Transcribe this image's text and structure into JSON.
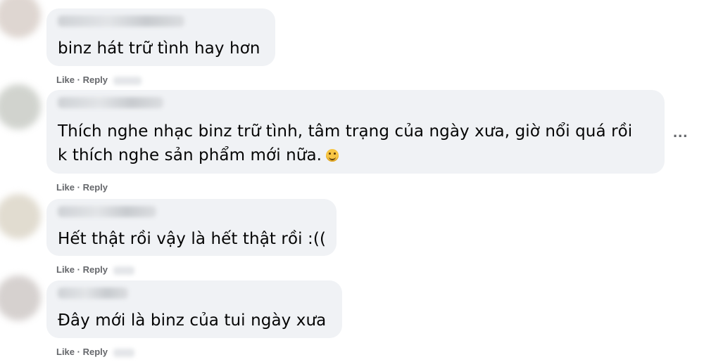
{
  "comments": [
    {
      "text": "binz hát trữ tình hay hơn",
      "like_label": "Like",
      "separator": "·",
      "reply_label": "Reply"
    },
    {
      "text_line1": "Thích nghe nhạc binz trữ tình, tâm trạng của ngày xưa, giờ nổi quá rồi",
      "text_line2": "k thích nghe sản phẩm mới nữa.",
      "emoji_icon": "smiling-face-icon",
      "like_label": "Like",
      "separator": "·",
      "reply_label": "Reply",
      "more_label": "..."
    },
    {
      "text": "Hết thật rồi vậy là hết thật rồi :((",
      "like_label": "Like",
      "separator": "·",
      "reply_label": "Reply"
    },
    {
      "text": "Đây mới là binz của tui ngày xưa",
      "like_label": "Like",
      "separator": "·",
      "reply_label": "Reply"
    }
  ],
  "colors": {
    "bubble": "#f0f2f5",
    "text": "#050505",
    "secondary": "#65676b"
  }
}
